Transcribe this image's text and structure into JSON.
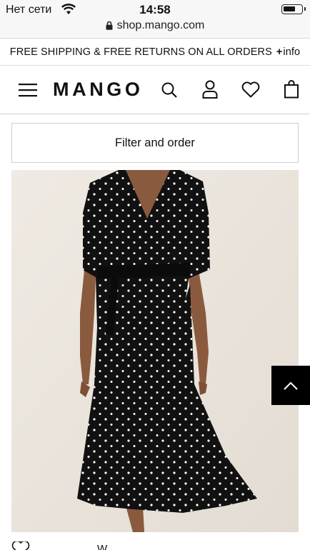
{
  "status_bar": {
    "carrier": "Нет сети",
    "time": "14:58",
    "battery_level": 0.7
  },
  "browser": {
    "url": "shop.mango.com"
  },
  "promo": {
    "text": "FREE SHIPPING & FREE RETURNS ON ALL ORDERS",
    "info_prefix": "+",
    "info_label": "info"
  },
  "header": {
    "logo": "MANGO",
    "icons": [
      "menu-icon",
      "search-icon",
      "user-icon",
      "heart-icon",
      "bag-icon"
    ]
  },
  "filter": {
    "label": "Filter and order"
  },
  "product": {
    "image_alt": "black polka-dot wrap midi dress",
    "colors": {
      "dress": "#111111",
      "dots": "#ffffff",
      "background": "#ebe5dd",
      "skin": "#8a5a3e"
    },
    "name_partial": "W..."
  },
  "back_to_top": {
    "icon": "chevron-up-icon"
  }
}
